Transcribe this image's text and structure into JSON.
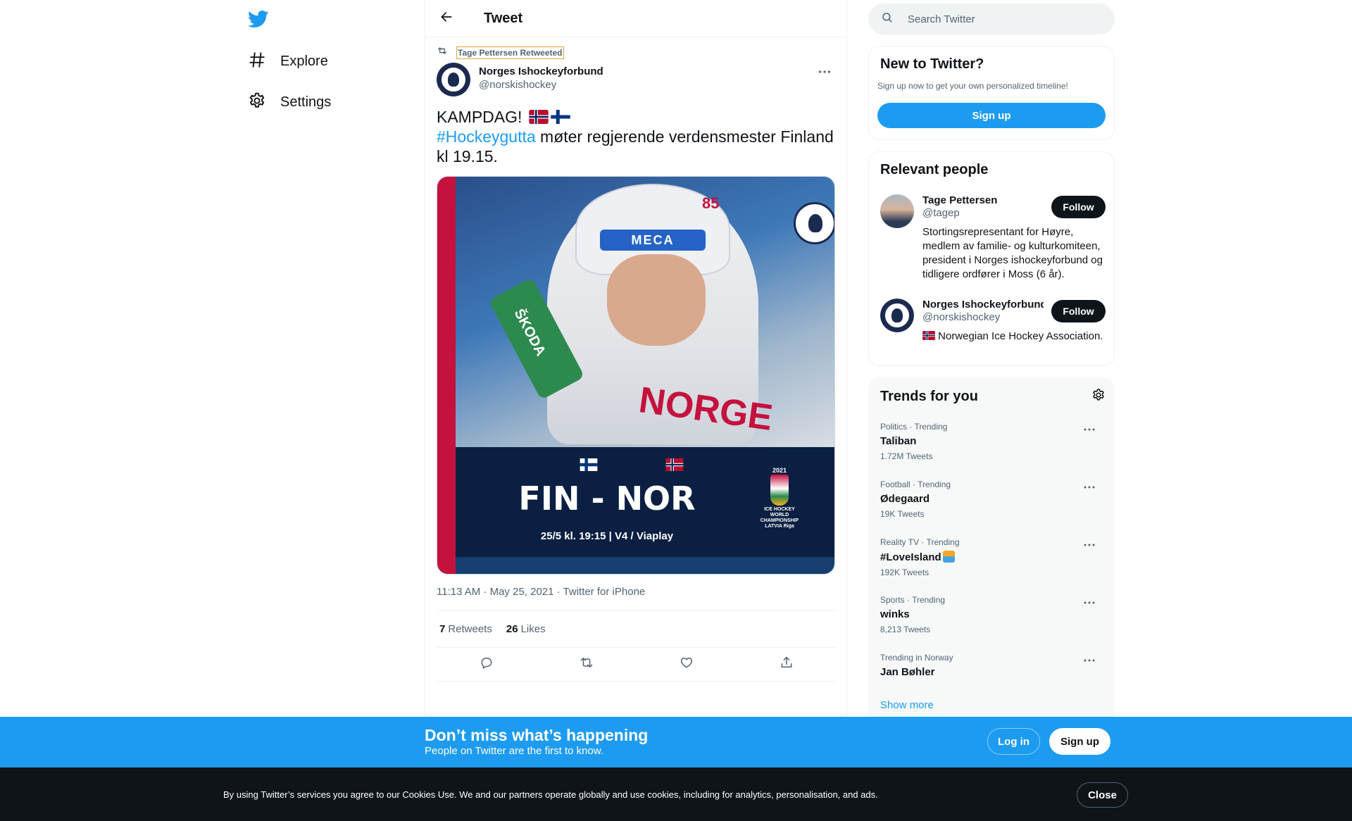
{
  "nav": {
    "items": [
      {
        "label": "Explore",
        "icon": "hashtag-icon"
      },
      {
        "label": "Settings",
        "icon": "gear-icon"
      }
    ]
  },
  "header": {
    "title": "Tweet"
  },
  "tweet": {
    "retweeted_by": "Tage Pettersen Retweeted",
    "author_name": "Norges Ishockeyforbund",
    "author_handle": "@norskishockey",
    "text_line1": "KAMPDAG!",
    "hashtag": "#Hockeygutta",
    "text_rest": " møter regjerende verdensmester Finland kl 19.15.",
    "media": {
      "helmet_sponsor": "MECA",
      "number": "85",
      "sleeve_sponsor": "ŠKODA",
      "jersey_word": "NORGE",
      "title": "FIN - NOR",
      "subtitle": "25/5 kl. 19:15 | V4 / Viaplay",
      "iihf_year": "2021",
      "iihf_caption": "ICE HOCKEY WORLD CHAMPIONSHIP LATVIA Riga"
    },
    "timestamp": "11:13 AM · May 25, 2021 · Twitter for iPhone",
    "retweets_count": "7",
    "retweets_label": "Retweets",
    "likes_count": "26",
    "likes_label": "Likes"
  },
  "search": {
    "placeholder": "Search Twitter"
  },
  "new_to_twitter": {
    "title": "New to Twitter?",
    "subtitle": "Sign up now to get your own personalized timeline!",
    "button": "Sign up"
  },
  "relevant_people": {
    "title": "Relevant people",
    "people": [
      {
        "name": "Tage Pettersen",
        "handle": "@tagep",
        "bio": "Stortingsrepresentant for Høyre, medlem av familie- og kulturkomiteen, president i Norges ishockeyforbund og tidligere ordfører i Moss (6 år).",
        "button": "Follow"
      },
      {
        "name": "Norges Ishockeyforbund",
        "handle": "@norskishockey",
        "bio": "Norwegian Ice Hockey Association.",
        "button": "Follow"
      }
    ]
  },
  "trends": {
    "title": "Trends for you",
    "items": [
      {
        "meta": "Politics · Trending",
        "name": "Taliban",
        "count": "1.72M Tweets"
      },
      {
        "meta": "Football · Trending",
        "name": "Ødegaard",
        "count": "19K Tweets"
      },
      {
        "meta": "Reality TV · Trending",
        "name": "#LoveIsland",
        "count": "192K Tweets"
      },
      {
        "meta": "Sports · Trending",
        "name": "winks",
        "count": "8,213 Tweets"
      },
      {
        "meta": "Trending in Norway",
        "name": "Jan Bøhler",
        "count": ""
      }
    ],
    "show_more": "Show more"
  },
  "signup_bar": {
    "title": "Don’t miss what’s happening",
    "subtitle": "People on Twitter are the first to know.",
    "login": "Log in",
    "signup": "Sign up"
  },
  "cookie_bar": {
    "text": "By using Twitter’s services you agree to our Cookies Use. We and our partners operate globally and use cookies, including for analytics, personalisation, and ads.",
    "close": "Close"
  },
  "colors": {
    "accent": "#1d9bf0",
    "text": "#0f1419",
    "muted": "#536471",
    "dark_bar": "#0f1419"
  }
}
